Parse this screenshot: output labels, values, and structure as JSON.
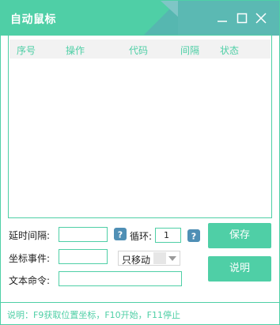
{
  "window": {
    "title": "自动鼠标"
  },
  "list": {
    "columns": [
      "序号",
      "操作",
      "代码",
      "间隔",
      "状态"
    ]
  },
  "form": {
    "delay_label": "延时间隔:",
    "delay_value": "",
    "loop_label": "循环:",
    "loop_value": "1",
    "event_label": "坐标事件:",
    "event_value": "",
    "event_type_selected": "只移动",
    "text_cmd_label": "文本命令:",
    "text_cmd_value": ""
  },
  "buttons": {
    "save": "保存",
    "help": "说明"
  },
  "status": {
    "text": "说明：F9获取位置坐标，F10开始，F11停止"
  },
  "colors": {
    "accent": "#4fcfa6",
    "title_deco": "#5bb9b3",
    "help_icon": "#4f8fb5"
  },
  "icons": [
    "minimize-icon",
    "maximize-icon",
    "close-icon",
    "help-icon",
    "chevron-down-icon"
  ]
}
